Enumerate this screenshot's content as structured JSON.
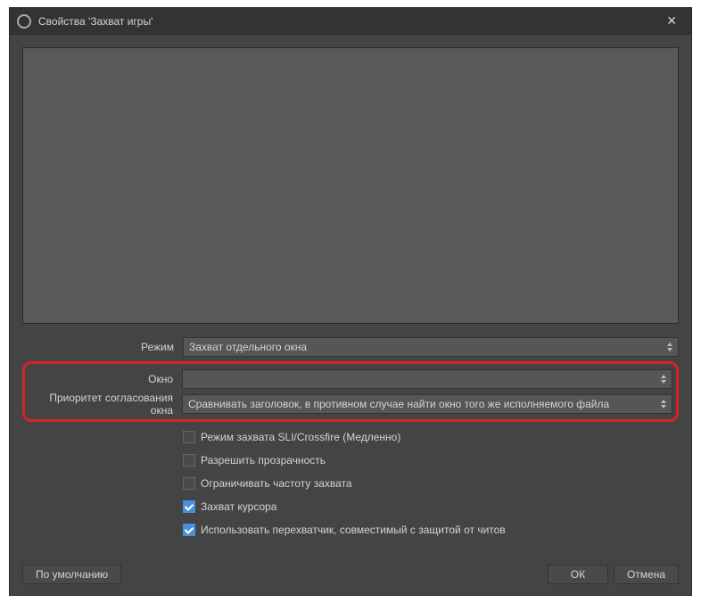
{
  "window": {
    "title": "Свойства 'Захват игры'"
  },
  "fields": {
    "mode": {
      "label": "Режим",
      "value": "Захват отдельного окна"
    },
    "window_sel": {
      "label": "Окно",
      "value": ""
    },
    "priority": {
      "label": "Приоритет согласования окна",
      "value": "Сравнивать заголовок, в противном случае найти окно того же исполняемого файла"
    }
  },
  "checks": {
    "sli": {
      "label": "Режим захвата SLI/Crossfire (Медленно)",
      "checked": false
    },
    "transparency": {
      "label": "Разрешить прозрачность",
      "checked": false
    },
    "limit_fps": {
      "label": "Ограничивать частоту захвата",
      "checked": false
    },
    "cursor": {
      "label": "Захват курсора",
      "checked": true
    },
    "anticheat": {
      "label": "Использовать перехватчик, совместимый с защитой от читов",
      "checked": true
    }
  },
  "buttons": {
    "default": "По умолчанию",
    "ok": "ОК",
    "cancel": "Отмена"
  }
}
